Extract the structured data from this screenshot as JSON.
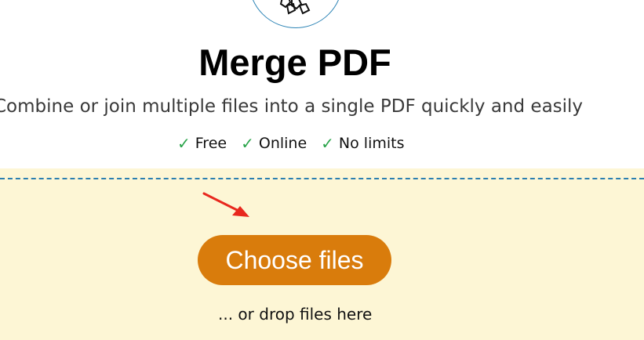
{
  "header": {
    "logo_icon": "merge-files-logo-icon",
    "title": "Merge PDF",
    "subtitle": "Combine or join multiple files into a single PDF quickly and easily"
  },
  "features": [
    {
      "check": "✓",
      "label": "Free"
    },
    {
      "check": "✓",
      "label": "Online"
    },
    {
      "check": "✓",
      "label": "No limits"
    }
  ],
  "upload": {
    "button_label": "Choose files",
    "drop_hint": "... or drop files here",
    "arrow_icon": "pointer-arrow-icon"
  },
  "colors": {
    "accent": "#d97c0c",
    "check": "#2aa44a",
    "drop_background": "#fdf6d5",
    "dash": "#2b7fb0",
    "arrow": "#e8281e"
  }
}
